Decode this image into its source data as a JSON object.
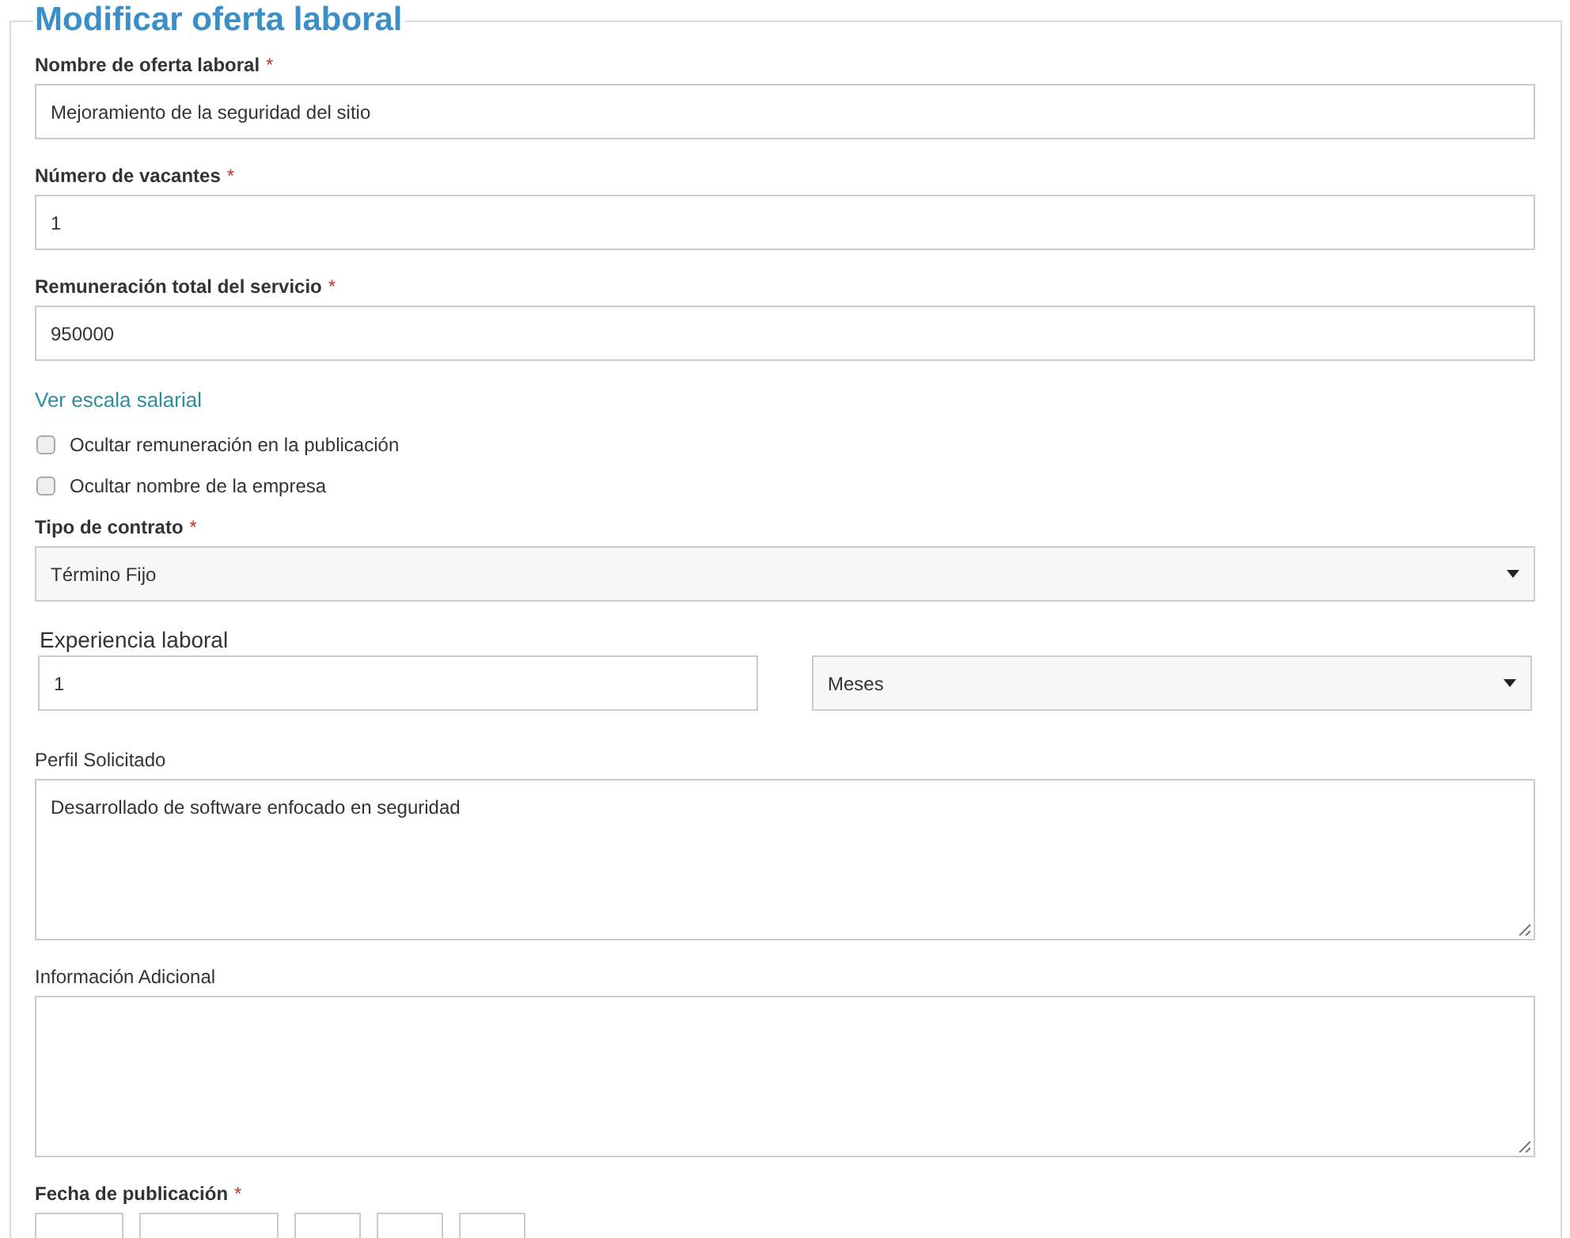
{
  "title": "Modificar oferta laboral",
  "fields": [
    {
      "kind": "text",
      "label": "Nombre de oferta laboral",
      "required_mark": "*",
      "value": "Mejoramiento de la seguridad del sitio"
    },
    {
      "kind": "text",
      "label": "Número de vacantes",
      "required_mark": "*",
      "value": "1"
    },
    {
      "kind": "text",
      "label": "Remuneración total del servicio",
      "required_mark": "*",
      "value": "950000"
    },
    {
      "kind": "link",
      "label": "Ver escala salarial"
    },
    {
      "kind": "checkbox",
      "label": "Ocultar remuneración en la publicación",
      "checked": false
    },
    {
      "kind": "checkbox",
      "label": "Ocultar nombre de la empresa",
      "checked": false
    },
    {
      "kind": "select",
      "label": "Tipo de contrato",
      "required_mark": "*",
      "value": "Término Fijo"
    },
    {
      "kind": "pair",
      "label": "Experiencia laboral",
      "value": "1",
      "unit": "Meses"
    },
    {
      "kind": "textarea",
      "label": "Perfil Solicitado",
      "value": "Desarrollado de software enfocado en seguridad"
    },
    {
      "kind": "textarea",
      "label": "Información Adicional"
    },
    {
      "kind": "date",
      "label": "Fecha de publicación",
      "required_mark": "*"
    }
  ]
}
